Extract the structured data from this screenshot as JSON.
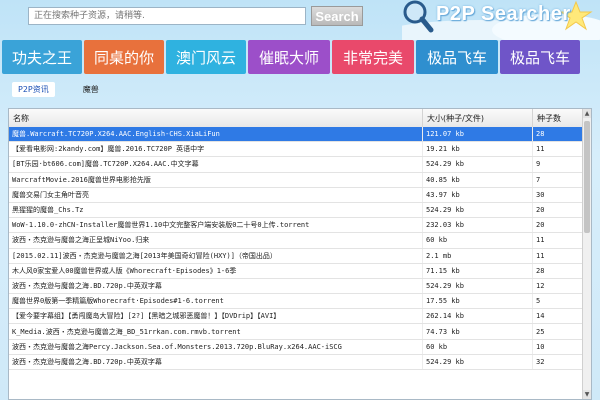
{
  "search": {
    "placeholder": "正在搜索种子资源，请稍等.",
    "button_label": "Search"
  },
  "logo": {
    "text": "P2P Searcher"
  },
  "nav": {
    "tabs": [
      {
        "label": "功夫之王",
        "color": "#3aa3d8"
      },
      {
        "label": "同桌的你",
        "color": "#e8713c"
      },
      {
        "label": "澳门风云",
        "color": "#2fb2e0"
      },
      {
        "label": "催眠大师",
        "color": "#9c4fc9"
      },
      {
        "label": "非常完美",
        "color": "#e9496b"
      },
      {
        "label": "极品飞车",
        "color": "#2f8fcf"
      },
      {
        "label": "极品飞车",
        "color": "#6f55c8"
      }
    ]
  },
  "breadcrumb": {
    "link": "P2P资讯",
    "current": "魔兽"
  },
  "table": {
    "headers": {
      "name": "名称",
      "size": "大小(种子/文件)",
      "seeds": "种子数"
    },
    "rows": [
      {
        "name": "魔兽.Warcraft.TC720P.X264.AAC.English-CHS.XiaLiFun",
        "size": "121.07 kb",
        "seeds": "28"
      },
      {
        "name": "【爱看电影网:2kandy.com】魔兽.2016.TC720P 英语中字",
        "size": "19.21 kb",
        "seeds": "11"
      },
      {
        "name": "[BT乐园·bt606.com]魔兽.TC720P.X264.AAC.中文字幕",
        "size": "524.29 kb",
        "seeds": "9"
      },
      {
        "name": "WarcraftMovie.2016魔兽世界电影抢先版",
        "size": "40.85 kb",
        "seeds": "7"
      },
      {
        "name": "魔兽交易门女主角叶音亮",
        "size": "43.97 kb",
        "seeds": "30"
      },
      {
        "name": "黑猩猩的魔兽_Chs.Tz",
        "size": "524.29 kb",
        "seeds": "20"
      },
      {
        "name": "WoW-1.10.0-zhCN-Installer魔兽世界1.10中文完整客户端安装版0二十号0上传.torrent",
        "size": "232.03 kb",
        "seeds": "20"
      },
      {
        "name": "波西・杰克逊与魔兽之海正呈城NiYoo.归来",
        "size": "60 kb",
        "seeds": "11"
      },
      {
        "name": "[2015.02.11]波西・杰克逊与魔兽之海[2013年美国奇幻冒险(HXY)]（帝国出品）",
        "size": "2.1 mb",
        "seeds": "11"
      },
      {
        "name": "木人风0家宝爱人00魔兽世界或人版《Whorecraft·Episodes》1-6季",
        "size": "71.15 kb",
        "seeds": "28"
      },
      {
        "name": "波西・杰克逊与魔兽之海.BD.720p.中英双字幕",
        "size": "524.29 kb",
        "seeds": "12"
      },
      {
        "name": "魔兽世界0版第一季精篇版Whorecraft·Episodes#1-6.torrent",
        "size": "17.55 kb",
        "seeds": "5"
      },
      {
        "name": "【爱今要字幕组】【勇闯魔岛大冒险】[2?]【黑暗之城邪恶魔兽！】【DVDrip】【AVI】",
        "size": "262.14 kb",
        "seeds": "14"
      },
      {
        "name": "K_Media.波西・杰克逊与魔兽之海_BD_51rrkan.com.rmvb.torrent",
        "size": "74.73 kb",
        "seeds": "25"
      },
      {
        "name": "波西・杰克逊与魔兽之海Percy.Jackson.Sea.of.Monsters.2013.720p.BluRay.x264.AAC-iSCG",
        "size": "60 kb",
        "seeds": "10"
      },
      {
        "name": "波西・杰克逊与魔兽之海.BD.720p.中英双字幕",
        "size": "524.29 kb",
        "seeds": "32"
      }
    ]
  }
}
